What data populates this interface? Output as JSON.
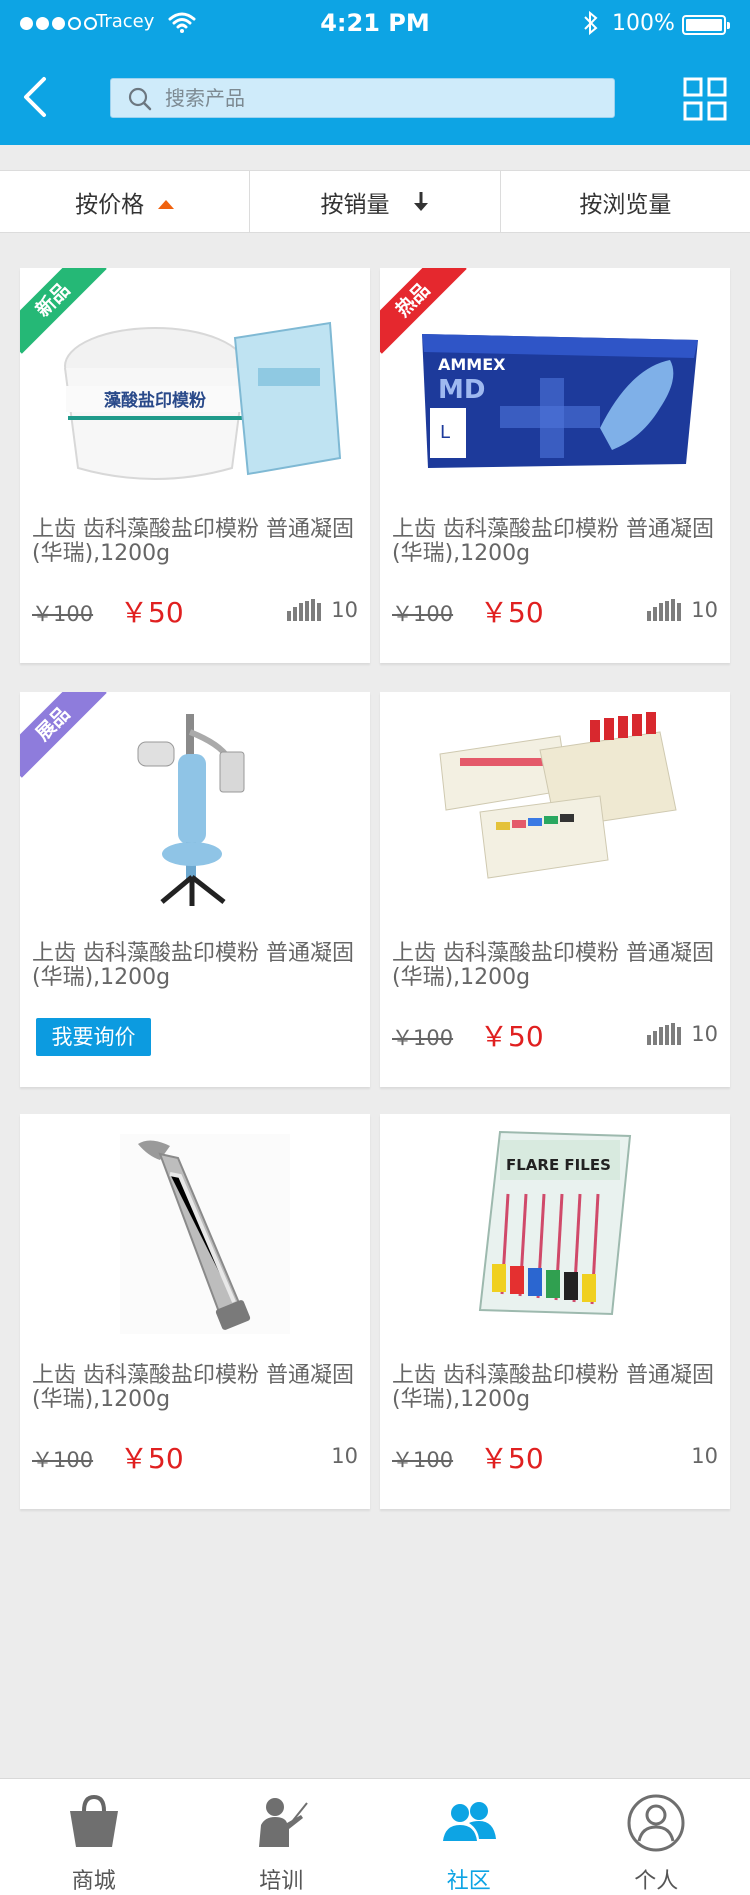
{
  "status": {
    "carrier": "Tracey",
    "time": "4:21 PM",
    "battery": "100%"
  },
  "header": {
    "search_placeholder": "搜索产品"
  },
  "sort": {
    "price": "按价格",
    "sales": "按销量",
    "views": "按浏览量"
  },
  "products": [
    {
      "badge": "新品",
      "title": "上齿 齿科藻酸盐印模粉 普通凝固(华瑞),1200g",
      "old_price": "￥100",
      "price": "￥50",
      "views": "10"
    },
    {
      "badge": "热品",
      "title": "上齿 齿科藻酸盐印模粉 普通凝固(华瑞),1200g",
      "old_price": "￥100",
      "price": "￥50",
      "views": "10"
    },
    {
      "badge": "展品",
      "title": "上齿 齿科藻酸盐印模粉 普通凝固(华瑞),1200g",
      "button": "我要询价"
    },
    {
      "title": "上齿 齿科藻酸盐印模粉 普通凝固(华瑞),1200g",
      "old_price": "￥100",
      "price": "￥50",
      "views": "10"
    },
    {
      "title": "上齿 齿科藻酸盐印模粉 普通凝固(华瑞),1200g",
      "old_price": "￥100",
      "price": "￥50",
      "views": "10"
    },
    {
      "title": "上齿 齿科藻酸盐印模粉 普通凝固(华瑞),1200g",
      "old_price": "￥100",
      "price": "￥50",
      "views": "10"
    }
  ],
  "product_images": {
    "p1_label": "藻酸盐印模粉",
    "p2_brand": "AMMEX",
    "p2_model": "MD",
    "p2_size": "L",
    "p6_label": "FLARE FILES"
  },
  "tabs": [
    {
      "label": "商城",
      "icon": "shopping-bag-icon"
    },
    {
      "label": "培训",
      "icon": "teacher-icon"
    },
    {
      "label": "社区",
      "icon": "community-icon"
    },
    {
      "label": "个人",
      "icon": "profile-icon"
    }
  ],
  "colors": {
    "brand": "#0da4e4",
    "price": "#e02020",
    "badge_new": "#25b876",
    "badge_hot": "#e5282e",
    "badge_exhibit": "#8e7cdc",
    "sort_arrow": "#f0620f"
  }
}
